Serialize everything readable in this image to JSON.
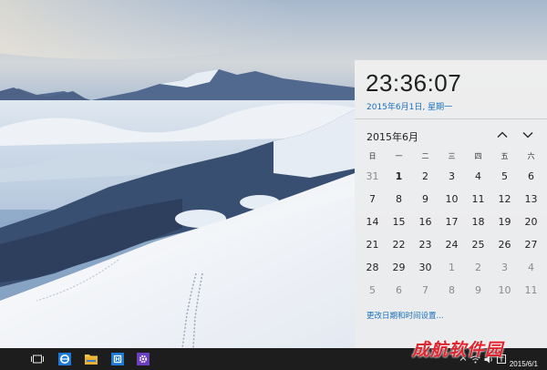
{
  "flyout": {
    "time": "23:36:07",
    "date_long": "2015年6月1日, 星期一",
    "month_label": "2015年6月",
    "weekdays": [
      "日",
      "一",
      "二",
      "三",
      "四",
      "五",
      "六"
    ],
    "days": [
      {
        "d": "31",
        "other": true
      },
      {
        "d": "1"
      },
      {
        "d": "2"
      },
      {
        "d": "3"
      },
      {
        "d": "4"
      },
      {
        "d": "5"
      },
      {
        "d": "6"
      },
      {
        "d": "7"
      },
      {
        "d": "8"
      },
      {
        "d": "9"
      },
      {
        "d": "10"
      },
      {
        "d": "11"
      },
      {
        "d": "12"
      },
      {
        "d": "13"
      },
      {
        "d": "14"
      },
      {
        "d": "15"
      },
      {
        "d": "16"
      },
      {
        "d": "17"
      },
      {
        "d": "18"
      },
      {
        "d": "19"
      },
      {
        "d": "20"
      },
      {
        "d": "21"
      },
      {
        "d": "22"
      },
      {
        "d": "23"
      },
      {
        "d": "24"
      },
      {
        "d": "25"
      },
      {
        "d": "26"
      },
      {
        "d": "27"
      },
      {
        "d": "28"
      },
      {
        "d": "29"
      },
      {
        "d": "30"
      },
      {
        "d": "1",
        "other": true
      },
      {
        "d": "2",
        "other": true
      },
      {
        "d": "3",
        "other": true
      },
      {
        "d": "4",
        "other": true
      },
      {
        "d": "5",
        "other": true
      },
      {
        "d": "6",
        "other": true
      },
      {
        "d": "7",
        "other": true
      },
      {
        "d": "8",
        "other": true
      },
      {
        "d": "9",
        "other": true
      },
      {
        "d": "10",
        "other": true
      },
      {
        "d": "11",
        "other": true
      }
    ],
    "today_value": "1",
    "change_link": "更改日期和时间设置..."
  },
  "taskbar": {
    "tray_date": "2015/6/1",
    "watermark": "成航软件园",
    "icons": [
      "task-view-icon",
      "edge-browser-icon",
      "file-explorer-icon",
      "store-icon",
      "settings-icon"
    ]
  },
  "colors": {
    "accent": "#1a6fbf",
    "flyout_bg": "#eeeeee",
    "taskbar_bg": "#1d1d1d"
  }
}
